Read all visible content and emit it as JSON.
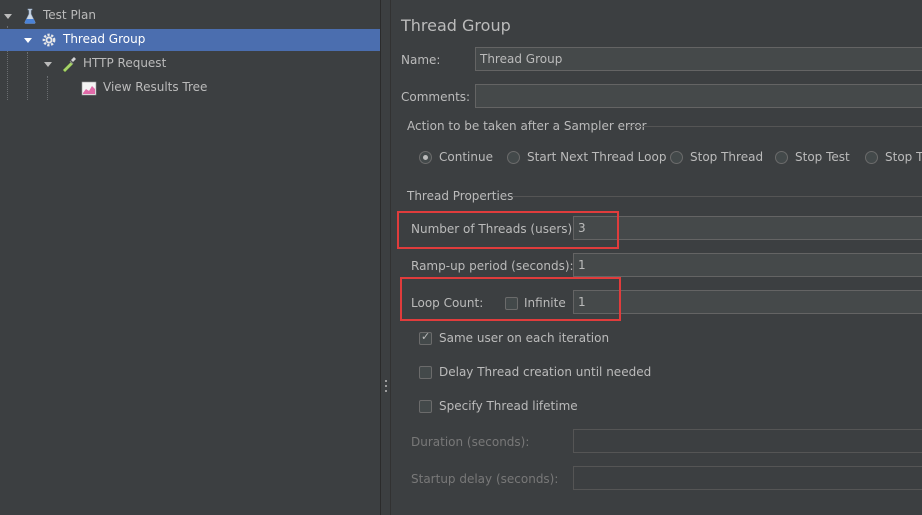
{
  "tree": {
    "items": [
      {
        "label": "Test Plan",
        "icon": "flask-icon"
      },
      {
        "label": "Thread Group",
        "icon": "gear-icon",
        "selected": true
      },
      {
        "label": "HTTP Request",
        "icon": "pipette-icon"
      },
      {
        "label": "View Results Tree",
        "icon": "chart-icon"
      }
    ]
  },
  "panel": {
    "title": "Thread Group",
    "name_label": "Name:",
    "name_value": "Thread Group",
    "comments_label": "Comments:",
    "comments_value": "",
    "sampler_error": {
      "heading": "Action to be taken after a Sampler error",
      "options": [
        "Continue",
        "Start Next Thread Loop",
        "Stop Thread",
        "Stop Test",
        "Stop Te"
      ],
      "selected": "Continue"
    },
    "thread_properties": {
      "heading": "Thread Properties",
      "num_threads_label": "Number of Threads (users):",
      "num_threads_value": "3",
      "rampup_label": "Ramp-up period (seconds):",
      "rampup_value": "1",
      "loop_label": "Loop Count:",
      "infinite_label": "Infinite",
      "infinite_checked": false,
      "loop_value": "1",
      "same_user_label": "Same user on each iteration",
      "same_user_checked": true,
      "delay_label": "Delay Thread creation until needed",
      "delay_checked": false,
      "lifetime_label": "Specify Thread lifetime",
      "lifetime_checked": false,
      "duration_label": "Duration (seconds):",
      "duration_value": "",
      "startup_label": "Startup delay (seconds):",
      "startup_value": ""
    }
  },
  "colors": {
    "selection": "#4b6eaf",
    "highlight": "#e03c3c",
    "background": "#3c3f41"
  }
}
